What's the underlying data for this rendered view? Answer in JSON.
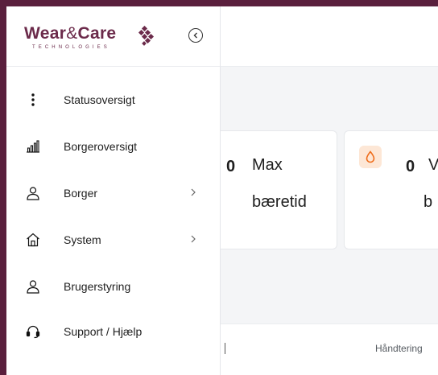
{
  "brand": {
    "name_left": "Wear",
    "name_amp": "&",
    "name_right": "Care",
    "subtitle": "TECHNOLOGIES",
    "color": "#6b2a4a"
  },
  "sidebar": {
    "collapse_icon": "circle-chevron-left-icon",
    "items": [
      {
        "label": "Statusoversigt",
        "icon": "vertical-dots-icon",
        "has_submenu": false
      },
      {
        "label": "Borgeroversigt",
        "icon": "bar-chart-icon",
        "has_submenu": false
      },
      {
        "label": "Borger",
        "icon": "person-icon",
        "has_submenu": true
      },
      {
        "label": "System",
        "icon": "home-icon",
        "has_submenu": true
      },
      {
        "label": "Brugerstyring",
        "icon": "person-icon",
        "has_submenu": false
      },
      {
        "label": "Support / Hjælp",
        "icon": "headset-icon",
        "has_submenu": false
      }
    ]
  },
  "cards": [
    {
      "value": "0",
      "label_line1": "Max",
      "label_line2": "bæretid"
    },
    {
      "value": "0",
      "label_line1": "V",
      "label_line2": "b",
      "icon": "drop-icon",
      "icon_bg": "#fde7d6",
      "icon_color": "#ef6c1a"
    }
  ],
  "footer": {
    "column_label": "Håndtering"
  },
  "colors": {
    "frame": "#5a1f3d",
    "background": "#f4f5f7"
  }
}
